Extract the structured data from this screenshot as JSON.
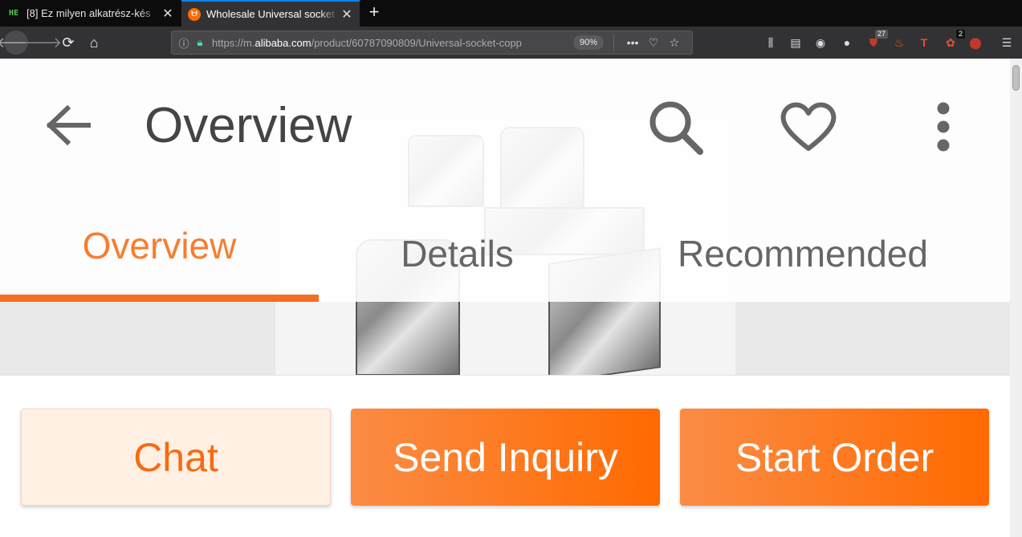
{
  "browser": {
    "tabs": [
      {
        "favicon": "HE",
        "title": "[8] Ez milyen alkatrész-kés"
      },
      {
        "favicon": "alibaba-icon",
        "title": "Wholesale Universal socket"
      }
    ],
    "url_prefix": "https://m.",
    "url_domain": "alibaba.com",
    "url_suffix": "/product/60787090809/Universal-socket-copp",
    "zoom": "90%",
    "ext_badge_1": "27",
    "ext_badge_2": "2"
  },
  "page": {
    "title": "Overview",
    "tabs": [
      "Overview",
      "Details",
      "Recommended"
    ],
    "active_tab": 0,
    "accent_color": "#f77d2f"
  },
  "actions": {
    "chat": "Chat",
    "send_inquiry": "Send Inquiry",
    "start_order": "Start Order"
  }
}
